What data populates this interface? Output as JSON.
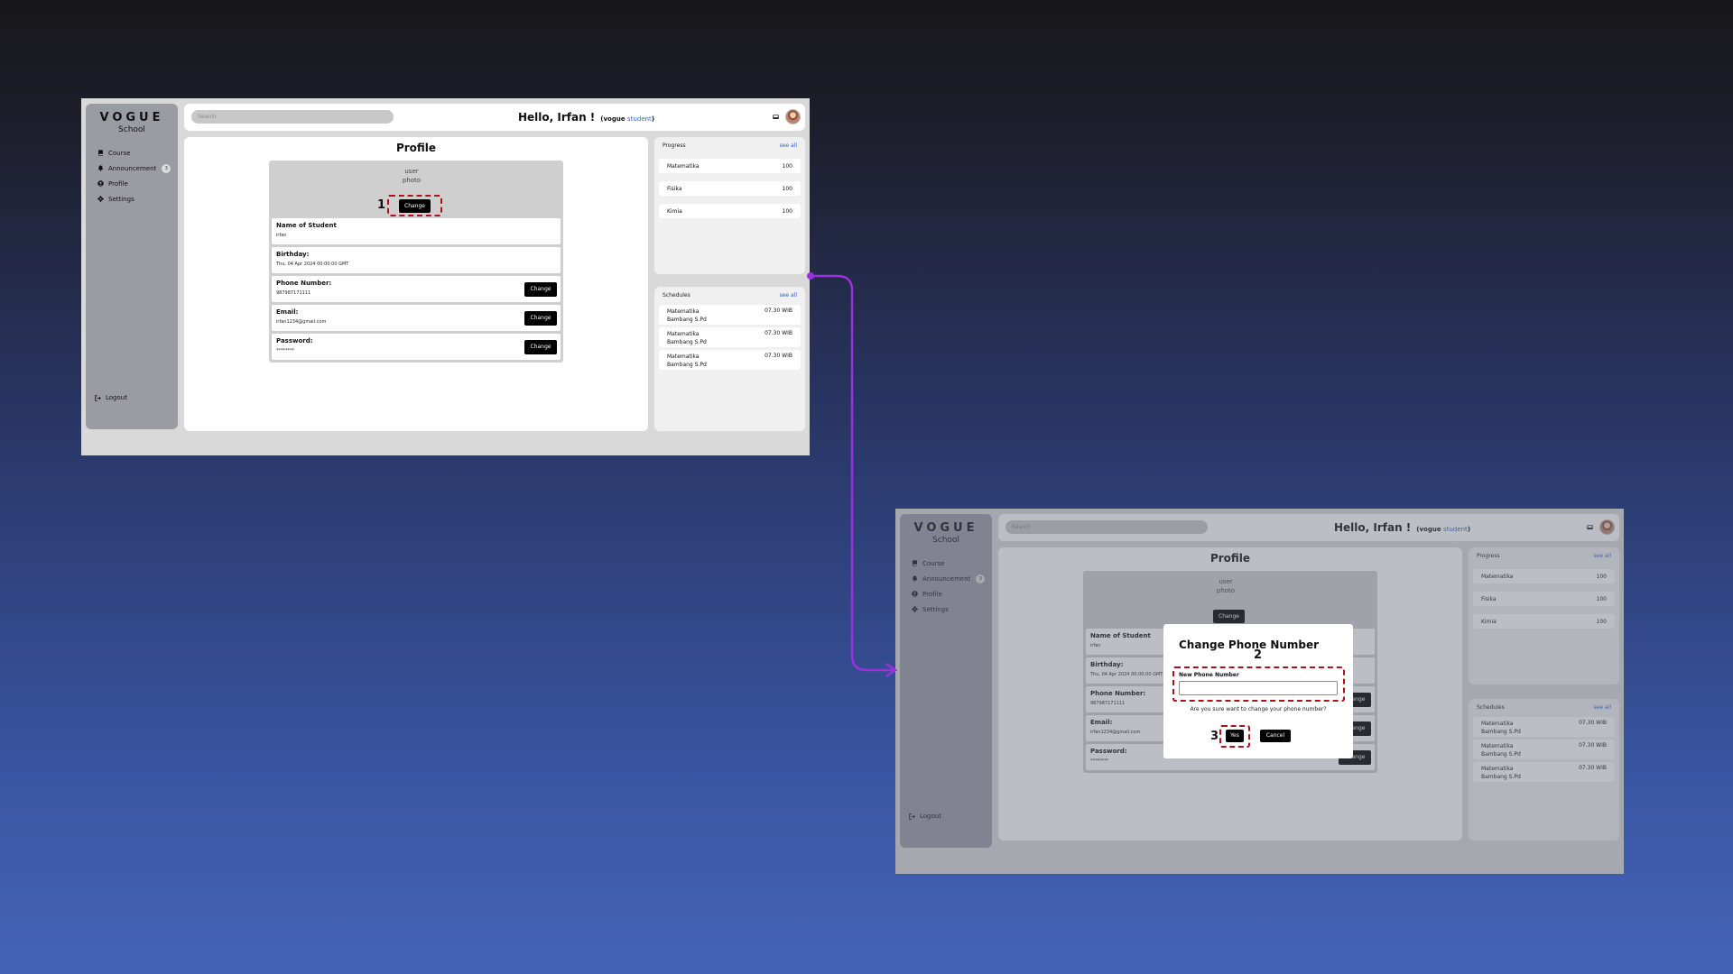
{
  "accent_color": "#2d62c9",
  "connector_color": "#9b30e0",
  "highlight_color": "#b0101e",
  "app": {
    "logo_title": "VOGUE",
    "logo_subtitle": "School",
    "search_placeholder": "Search",
    "greeting": "Hello, Irfan !",
    "role_prefix": "(vogue ",
    "role": "student",
    "role_suffix": ")"
  },
  "sidebar": {
    "items": [
      {
        "label": "Course",
        "icon": "book-icon"
      },
      {
        "label": "Announcement",
        "icon": "bell-icon",
        "badge": "3"
      },
      {
        "label": "Profile",
        "icon": "user-circle-icon"
      },
      {
        "label": "Settings",
        "icon": "gear-icon"
      }
    ],
    "logout": "Logout"
  },
  "profile": {
    "title": "Profile",
    "photo_alt": "user photo",
    "change_label": "Change",
    "fields": [
      {
        "label": "Name of Student",
        "value": "irfan"
      },
      {
        "label": "Birthday:",
        "value": "Thu, 04 Apr 2024 00:00:00 GMT"
      },
      {
        "label": "Phone Number:",
        "value": "987987171111"
      },
      {
        "label": "Email:",
        "value": "irfan1234@gmail.com"
      },
      {
        "label": "Password:",
        "value": "********"
      }
    ]
  },
  "progress": {
    "title": "Progress",
    "see_all": "see all",
    "items": [
      {
        "subject": "Matematika",
        "value": "100"
      },
      {
        "subject": "Fisika",
        "value": "100"
      },
      {
        "subject": "Kimia",
        "value": "100"
      }
    ]
  },
  "schedules": {
    "title": "Schedules",
    "see_all": "see all",
    "items": [
      {
        "subject": "Matematika",
        "teacher": "Bambang S.Pd",
        "time": "07.30 WIB"
      },
      {
        "subject": "Matematika",
        "teacher": "Bambang S.Pd",
        "time": "07.30 WIB"
      },
      {
        "subject": "Matematika",
        "teacher": "Bambang S.Pd",
        "time": "07.30 WIB"
      }
    ]
  },
  "modal": {
    "title": "Change Phone Number",
    "input_label": "New Phone Number",
    "input_value": "",
    "confirm_text": "Are you sure want to change your phone number?",
    "yes_label": "Yes",
    "cancel_label": "Cancel"
  },
  "steps": {
    "one": "1",
    "two": "2",
    "three": "3"
  }
}
